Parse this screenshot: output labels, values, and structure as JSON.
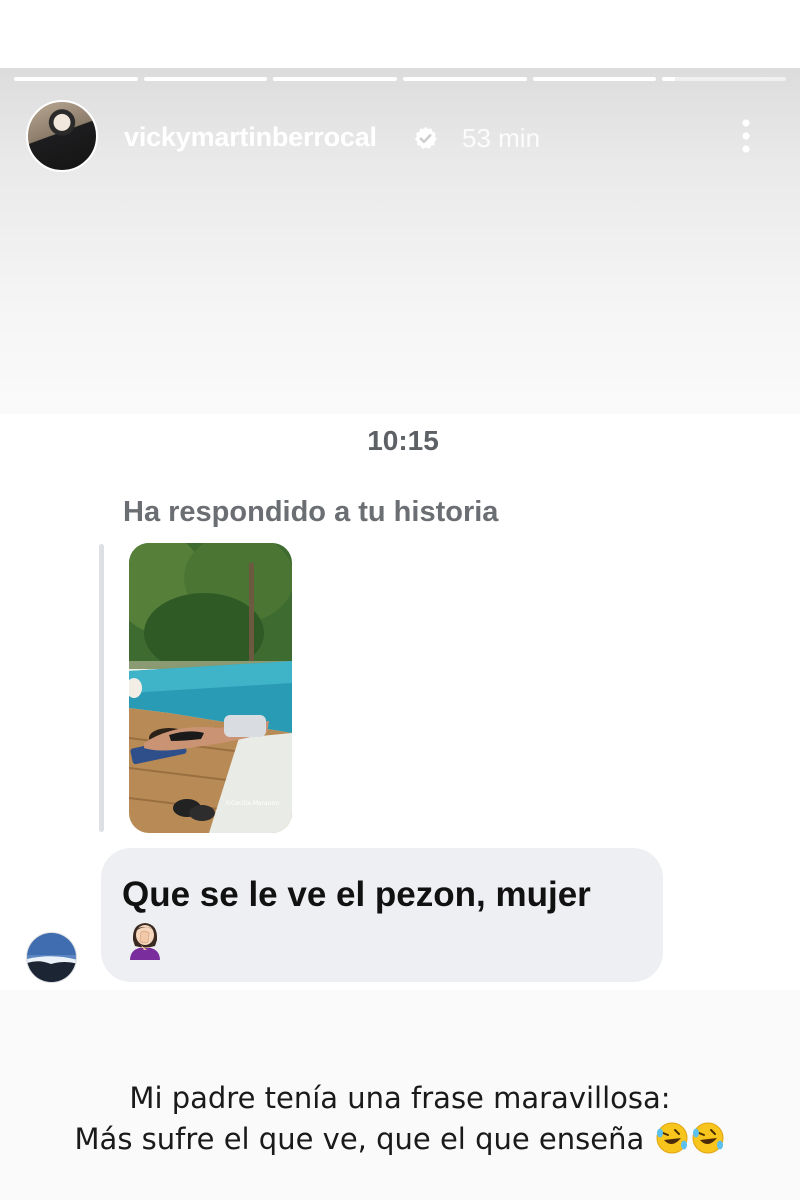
{
  "story": {
    "progress": [
      1,
      1,
      1,
      1,
      1,
      0.1
    ],
    "username": "vickymartinberrocal",
    "time_ago": "53 min",
    "verified": true
  },
  "dm": {
    "timestamp": "10:15",
    "reply_label": "Ha respondido a tu historia",
    "message_text": "Que se le ve el pezon, mujer",
    "message_emoji": "woman-facepalming-icon",
    "thumbnail_caption": "©Cecilia Maranno"
  },
  "caption": {
    "line1": "Mi padre tenía una frase maravillosa:",
    "line2": "Más sufre el que ve, que el que enseña",
    "trailing_emojis": [
      "rolling-on-floor-laughing-icon",
      "rolling-on-floor-laughing-icon"
    ]
  },
  "colors": {
    "bubble": "#eeeff2",
    "label_gray": "#6b6f73",
    "verified_white": "#ffffff"
  }
}
